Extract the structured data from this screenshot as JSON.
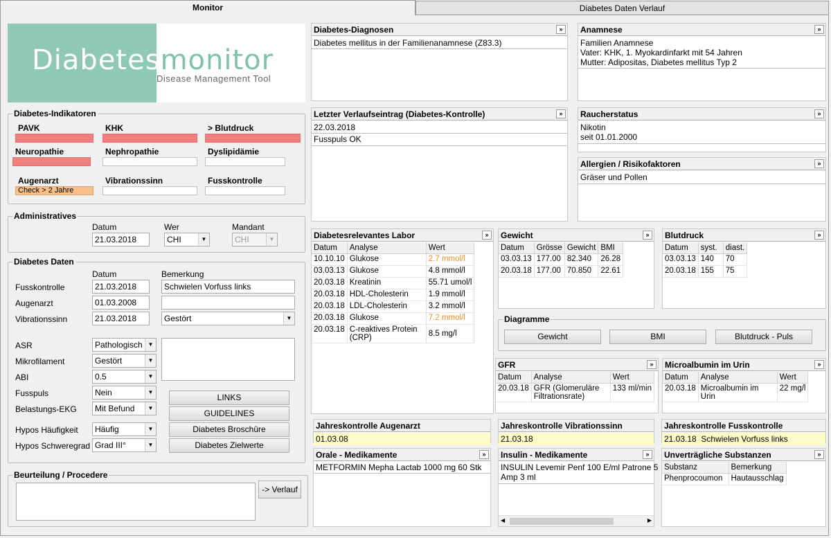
{
  "tabs": {
    "monitor": "Monitor",
    "verlauf": "Diabetes Daten Verlauf"
  },
  "logo": {
    "part1": "Diabetes",
    "part2": "monitor",
    "subtitle": "Disease Management Tool"
  },
  "indikatoren": {
    "title": "Diabetes-Indikatoren",
    "items": [
      {
        "label": "PAVK",
        "status": "red",
        "value": ""
      },
      {
        "label": "KHK",
        "status": "red",
        "value": ""
      },
      {
        "label": "> Blutdruck",
        "status": "red",
        "value": ""
      },
      {
        "label": "Neuropathie",
        "status": "red",
        "value": ""
      },
      {
        "label": "Nephropathie",
        "status": "none",
        "value": ""
      },
      {
        "label": "Dyslipidämie",
        "status": "none",
        "value": ""
      },
      {
        "label": "Augenarzt",
        "status": "orange",
        "value": "Check > 2 Jahre"
      },
      {
        "label": "Vibrationssinn",
        "status": "none",
        "value": ""
      },
      {
        "label": "Fusskontrolle",
        "status": "none",
        "value": ""
      }
    ]
  },
  "admin": {
    "title": "Administratives",
    "datum_label": "Datum",
    "datum": "21.03.2018",
    "wer_label": "Wer",
    "wer": "CHI",
    "mandant_label": "Mandant",
    "mandant": "CHI"
  },
  "daten": {
    "title": "Diabetes Daten",
    "col_datum": "Datum",
    "col_bemerkung": "Bemerkung",
    "fusskontrolle": {
      "label": "Fusskontrolle",
      "datum": "21.03.2018",
      "bemerkung": "Schwielen Vorfuss links"
    },
    "augenarzt": {
      "label": "Augenarzt",
      "datum": "01.03.2008",
      "bemerkung": ""
    },
    "vibrationssinn": {
      "label": "Vibrationssinn",
      "datum": "21.03.2018",
      "bemerkung": "Gestört"
    },
    "asr": {
      "label": "ASR",
      "value": "Pathologisch"
    },
    "mikrofilament": {
      "label": "Mikrofilament",
      "value": "Gestört"
    },
    "abi": {
      "label": "ABI",
      "value": "0.5"
    },
    "fusspuls": {
      "label": "Fusspuls",
      "value": "Nein"
    },
    "belastungs_ekg": {
      "label": "Belastungs-EKG",
      "value": "Mit Befund"
    },
    "hypos_haeufigkeit": {
      "label": "Hypos Häufigkeit",
      "value": "Häufig"
    },
    "hypos_schweregrad": {
      "label": "Hypos Schweregrad",
      "value": "Grad III°"
    },
    "buttons": {
      "links": "LINKS",
      "guidelines": "GUIDELINES",
      "broschuere": "Diabetes Broschüre",
      "zielwerte": "Diabetes Zielwerte"
    }
  },
  "beurteilung": {
    "title": "Beurteilung / Procedere",
    "button": "-> Verlauf"
  },
  "diagnosen": {
    "title": "Diabetes-Diagnosen",
    "lines": [
      "Diabetes mellitus in der Familienanamnese (Z83.3)"
    ]
  },
  "anamnese": {
    "title": "Anamnese",
    "lines": [
      "Familien Anamnese",
      "Vater: KHK, 1. Myokardinfarkt mit 54 Jahren",
      "Mutter: Adipositas, Diabetes mellitus Typ 2"
    ]
  },
  "verlaufseintrag": {
    "title": "Letzter Verlaufseintrag (Diabetes-Kontrolle)",
    "lines": [
      "22.03.2018",
      "Fusspuls OK"
    ]
  },
  "raucher": {
    "title": "Raucherstatus",
    "lines": [
      "Nikotin",
      "seit 01.01.2000"
    ]
  },
  "allergien": {
    "title": "Allergien / Risikofaktoren",
    "lines": [
      "Gräser und Pollen"
    ]
  },
  "labor": {
    "title": "Diabetesrelevantes Labor",
    "headers": [
      "Datum",
      "Analyse",
      "Wert"
    ],
    "rows": [
      {
        "datum": "10.10.10",
        "analyse": "Glukose",
        "wert": "2.7 mmol/l",
        "flag": true
      },
      {
        "datum": "03.03.13",
        "analyse": "Glukose",
        "wert": "4.8 mmol/l",
        "flag": false
      },
      {
        "datum": "20.03.18",
        "analyse": "Kreatinin",
        "wert": "55.71 umol/l",
        "flag": false
      },
      {
        "datum": "20.03.18",
        "analyse": "HDL-Cholesterin",
        "wert": "1.9 mmol/l",
        "flag": false
      },
      {
        "datum": "20.03.18",
        "analyse": "LDL-Cholesterin",
        "wert": "3.2 mmol/l",
        "flag": false
      },
      {
        "datum": "20.03.18",
        "analyse": "Glukose",
        "wert": "7.2 mmol/l",
        "flag": true
      },
      {
        "datum": "20.03.18",
        "analyse": "C-reaktives Protein (CRP)",
        "wert": "8.5 mg/l",
        "flag": false
      }
    ]
  },
  "gewicht": {
    "title": "Gewicht",
    "headers": [
      "Datum",
      "Grösse",
      "Gewicht",
      "BMI"
    ],
    "rows": [
      [
        "03.03.13",
        "177.00",
        "82.340",
        "26.28"
      ],
      [
        "20.03.18",
        "177.00",
        "70.850",
        "22.61"
      ]
    ]
  },
  "blutdruck": {
    "title": "Blutdruck",
    "headers": [
      "Datum",
      "syst.",
      "diast."
    ],
    "rows": [
      [
        "03.03.13",
        "140",
        "70"
      ],
      [
        "20.03.18",
        "155",
        "75"
      ]
    ]
  },
  "diagramme": {
    "title": "Diagramme",
    "gewicht": "Gewicht",
    "bmi": "BMI",
    "blutdruck": "Blutdruck - Puls"
  },
  "gfr": {
    "title": "GFR",
    "headers": [
      "Datum",
      "Analyse",
      "Wert"
    ],
    "rows": [
      [
        "20.03.18",
        "GFR (Glomeruläre Filtrationsrate)",
        "133 ml/min"
      ]
    ]
  },
  "microalbumin": {
    "title": "Microalbumin im Urin",
    "headers": [
      "Datum",
      "Analyse",
      "Wert"
    ],
    "rows": [
      [
        "20.03.18",
        "Microalbumin im Urin",
        "22 mg/l"
      ]
    ]
  },
  "jk_augenarzt": {
    "title": "Jahreskontrolle Augenarzt",
    "datum": "01.03.08",
    "text": ""
  },
  "jk_vibration": {
    "title": "Jahreskontrolle Vibrationssinn",
    "datum": "21.03.18",
    "text": ""
  },
  "jk_fuss": {
    "title": "Jahreskontrolle Fusskontrolle",
    "datum": "21.03.18",
    "text": "Schwielen Vorfuss links"
  },
  "orale_med": {
    "title": "Orale - Medikamente",
    "lines": [
      "METFORMIN Mepha Lactab 1000 mg 60 Stk"
    ]
  },
  "insulin_med": {
    "title": "Insulin - Medikamente",
    "lines": [
      "INSULIN Levemir Penf 100 E/ml Patrone 5",
      "Amp 3 ml"
    ]
  },
  "unvertraeglich": {
    "title": "Unverträgliche Substanzen",
    "headers": [
      "Substanz",
      "Bemerkung"
    ],
    "rows": [
      [
        "Phenprocoumon",
        "Hautausschlag"
      ]
    ]
  },
  "icons": {
    "more": "double-chevron-right-icon",
    "dropdown": "chevron-down-icon"
  }
}
